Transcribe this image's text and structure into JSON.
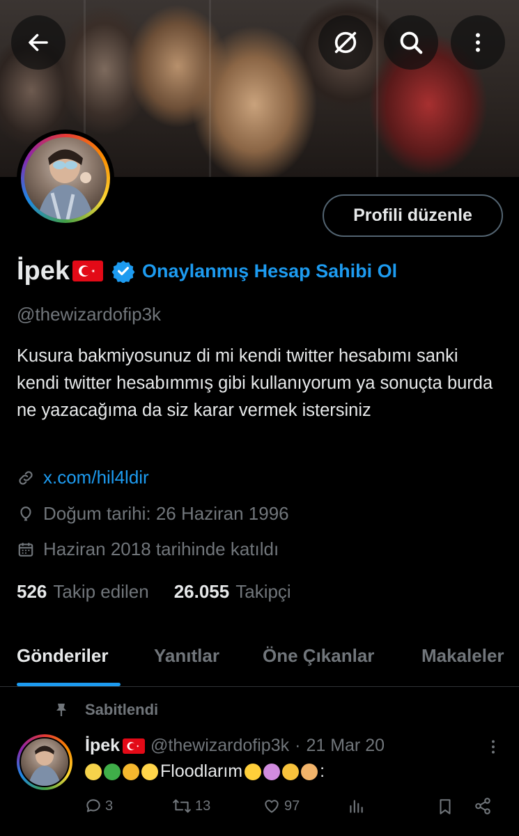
{
  "header": {
    "back_icon": "arrow-left-icon",
    "translate_icon": "slash-circle-icon",
    "search_icon": "search-icon",
    "more_icon": "more-vertical-icon"
  },
  "profile": {
    "edit_button": "Profili düzenle",
    "name": "İpek",
    "flag": "turkey-flag",
    "verify_cta": "Onaylanmış Hesap Sahibi Ol",
    "handle": "@thewizardofip3k",
    "bio": "Kusura bakmiyosunuz di mi kendi twitter hesabımı sanki kendi twitter hesabımmış gibi kullanıyorum ya sonuçta burda ne yazacağıma da siz karar vermek istersiniz",
    "link": "x.com/hil4ldir",
    "birthday": "Doğum tarihi: 26 Haziran 1996",
    "joined": "Haziran 2018 tarihinde katıldı",
    "following_count": "526",
    "following_label": "Takip edilen",
    "followers_count": "26.055",
    "followers_label": "Takipçi"
  },
  "tabs": [
    {
      "label": "Gönderiler",
      "active": true
    },
    {
      "label": "Yanıtlar",
      "active": false
    },
    {
      "label": "Öne Çıkanlar",
      "active": false
    },
    {
      "label": "Makaleler",
      "active": false
    }
  ],
  "pinned_post": {
    "pinned_label": "Sabitlendi",
    "author": "İpek",
    "handle": "@thewizardofip3k",
    "separator": "·",
    "date": "21 Mar 20",
    "text": "Floodlarım",
    "replies": "3",
    "reposts": "13",
    "likes": "97"
  },
  "colors": {
    "accent": "#1d9bf0",
    "muted": "#71767b",
    "text": "#e7e9ea",
    "background": "#000000"
  }
}
